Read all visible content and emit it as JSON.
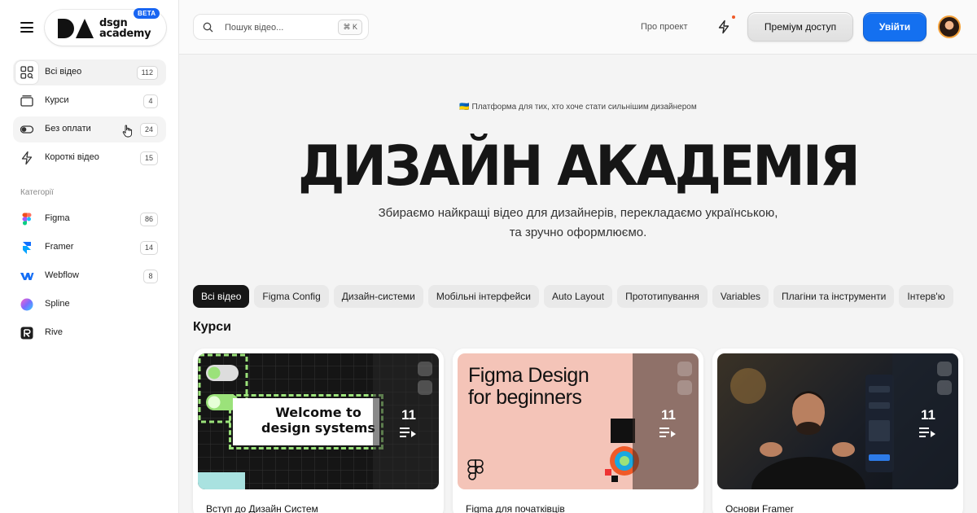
{
  "brand": {
    "logo_text_line1": "dsgn",
    "logo_text_line2": "academy",
    "beta_label": "BETA"
  },
  "sidebar": {
    "items": [
      {
        "label": "Всі відео",
        "count": "112",
        "icon": "grid-search-icon"
      },
      {
        "label": "Курси",
        "count": "4",
        "icon": "folder-icon"
      },
      {
        "label": "Без оплати",
        "count": "24",
        "icon": "toggle-icon"
      },
      {
        "label": "Короткі відео",
        "count": "15",
        "icon": "bolt-icon"
      }
    ],
    "categories_heading": "Категорії",
    "categories": [
      {
        "label": "Figma",
        "count": "86",
        "icon": "figma-icon"
      },
      {
        "label": "Framer",
        "count": "14",
        "icon": "framer-icon"
      },
      {
        "label": "Webflow",
        "count": "8",
        "icon": "webflow-icon"
      },
      {
        "label": "Spline",
        "count": "",
        "icon": "spline-icon"
      },
      {
        "label": "Rive",
        "count": "",
        "icon": "rive-icon"
      }
    ]
  },
  "header": {
    "search_placeholder": "Пошук відео...",
    "shortcut": "⌘ K",
    "about_label": "Про проект",
    "premium_label": "Преміум доступ",
    "login_label": "Увійти"
  },
  "hero": {
    "tagline": "🇺🇦 Платформа для тих, хто хоче стати сильнішим дизайнером",
    "title": "ДИЗАЙН АКАДЕМІЯ",
    "subtitle": "Збираємо найкращі відео для дизайнерів, перекладаємо українською, та зручно оформлюємо."
  },
  "filters": [
    "Всі відео",
    "Figma Config",
    "Дизайн-системи",
    "Мобільні інтерфейси",
    "Auto Layout",
    "Прототипування",
    "Variables",
    "Плагіни та інструменти",
    "Інтерв'ю"
  ],
  "courses_section_title": "Курси",
  "courses": [
    {
      "title": "Вступ до Дизайн Систем",
      "count": "11",
      "thumb_text": "Welcome to design systems"
    },
    {
      "title": "Figma для початківців",
      "count": "11",
      "thumb_text": "Figma Design for beginners"
    },
    {
      "title": "Основи Framer",
      "count": "11",
      "thumb_text": ""
    }
  ],
  "colors": {
    "accent": "#1470f0",
    "dark": "#161616",
    "lime": "#9be27a"
  }
}
